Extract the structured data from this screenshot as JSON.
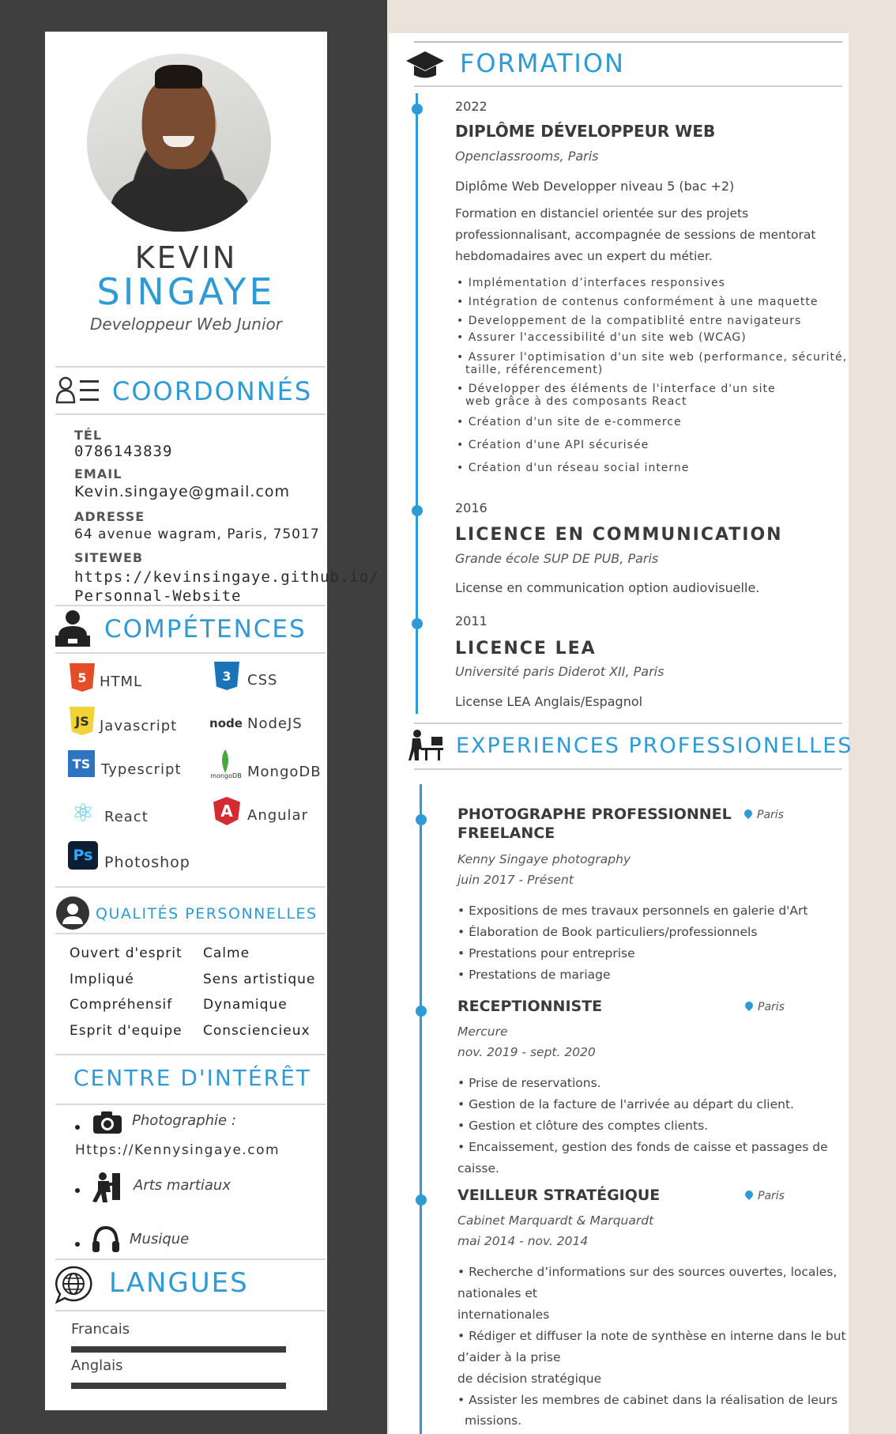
{
  "profile": {
    "first_name": "KEVIN",
    "last_name": "SINGAYE",
    "title": "Developpeur Web Junior"
  },
  "contact": {
    "heading": "COORDONNÉS",
    "tel_label": "TÉL",
    "tel": "0786143839",
    "email_label": "EMAIL",
    "email": "Kevin.singaye@gmail.com",
    "address_label": "ADRESSE",
    "address": "64 avenue wagram, Paris, 75017",
    "site_label": "SITEWEB",
    "site_line1": "https://kevinsingaye.github.io/",
    "site_line2": "Personnal-Website"
  },
  "skills": {
    "heading": "COMPÉTENCES",
    "items": [
      "HTML",
      "CSS",
      "Javascript",
      "NodeJS",
      "Typescript",
      "MongoDB",
      "React",
      "Angular",
      "Photoshop"
    ],
    "logos": [
      "5",
      "3",
      "JS",
      "node",
      "TS",
      "mongoDB",
      "⚛",
      "A",
      "Ps"
    ]
  },
  "qualities": {
    "heading": "QUALITÉS PERSONNELLES",
    "items": [
      "Ouvert d'esprit",
      "Calme",
      "Impliqué",
      "Sens artistique",
      "Compréhensif",
      "Dynamique",
      "Esprit d'equipe",
      "Consciencieux"
    ]
  },
  "interests": {
    "heading": "CENTRE D'INTÉRÊT",
    "photo": "Photographie :",
    "photo_site": "Https://Kennysingaye.com",
    "martial": "Arts martiaux",
    "music": "Musique"
  },
  "languages": {
    "heading": "LANGUES",
    "items": [
      {
        "name": "Francais",
        "level": 1.0
      },
      {
        "name": "Anglais",
        "level": 1.0
      }
    ]
  },
  "formation": {
    "heading": "FORMATION",
    "entries": [
      {
        "year": "2022",
        "degree": "DIPLÔME DÉVELOPPEUR WEB",
        "school": "Openclassrooms, Paris",
        "desc": "Diplôme Web Developper niveau 5 (bac +2)",
        "para": [
          "Formation en distanciel orientée sur des projets",
          "professionnalisant, accompagnée de sessions de mentorat",
          "hebdomadaires avec un expert du métier."
        ],
        "bullets": [
          "• Implémentation d’interfaces responsives",
          "• Intégration de contenus conformément à une maquette",
          "• Developpement de la compatiblité entre navigateurs",
          "• Assurer l'accessibilité d'un site web (WCAG)",
          "• Assurer l'optimisation d'un site web (performance, sécurité,",
          "taille, référencement)",
          "• Développer des éléments de l'interface d'un site",
          "web grâce à des composants React",
          "• Création d'un site de e-commerce",
          "• Création d'une API sécurisée",
          "• Création d'un réseau social interne"
        ]
      },
      {
        "year": "2016",
        "degree": "LICENCE EN COMMUNICATION",
        "school": "Grande école SUP DE PUB, Paris",
        "desc": "License en communication option audiovisuelle."
      },
      {
        "year": "2011",
        "degree": "LICENCE LEA",
        "school": "Université paris Diderot XII, Paris",
        "desc": "License LEA Anglais/Espagnol"
      }
    ]
  },
  "experiences": {
    "heading": "EXPERIENCES PROFESSIONELLES",
    "entries": [
      {
        "title1": "PHOTOGRAPHE PROFESSIONNEL",
        "title2": "FREELANCE",
        "location": "Paris",
        "company": "Kenny Singaye photography",
        "period": "juin 2017 - Présent",
        "bullets": [
          "• Expositions de mes travaux personnels en galerie d'Art",
          "• Élaboration de Book particuliers/professionnels",
          "• Prestations pour entreprise",
          "• Prestations de mariage"
        ]
      },
      {
        "title1": "RECEPTIONNISTE",
        "location": "Paris",
        "company": "Mercure",
        "period": "nov. 2019 - sept. 2020",
        "bullets": [
          "• Prise de reservations.",
          "• Gestion de la facture de l'arrivée au départ du client.",
          "• Gestion et clôture des comptes clients.",
          "• Encaissement, gestion des fonds de caisse et passages de",
          "caisse."
        ]
      },
      {
        "title1": "VEILLEUR STRATÉGIQUE",
        "location": "Paris",
        "company": "Cabinet Marquardt & Marquardt",
        "period": "mai 2014 - nov. 2014",
        "bullets": [
          "• Recherche d’informations sur des sources ouvertes, locales,",
          "nationales et",
          "internationales",
          "• Rédiger et diffuser la note de synthèse en interne dans le but",
          "d’aider à la prise",
          "de décision stratégique",
          "• Assister les membres de cabinet dans la réalisation de leurs",
          "missions."
        ]
      }
    ]
  }
}
